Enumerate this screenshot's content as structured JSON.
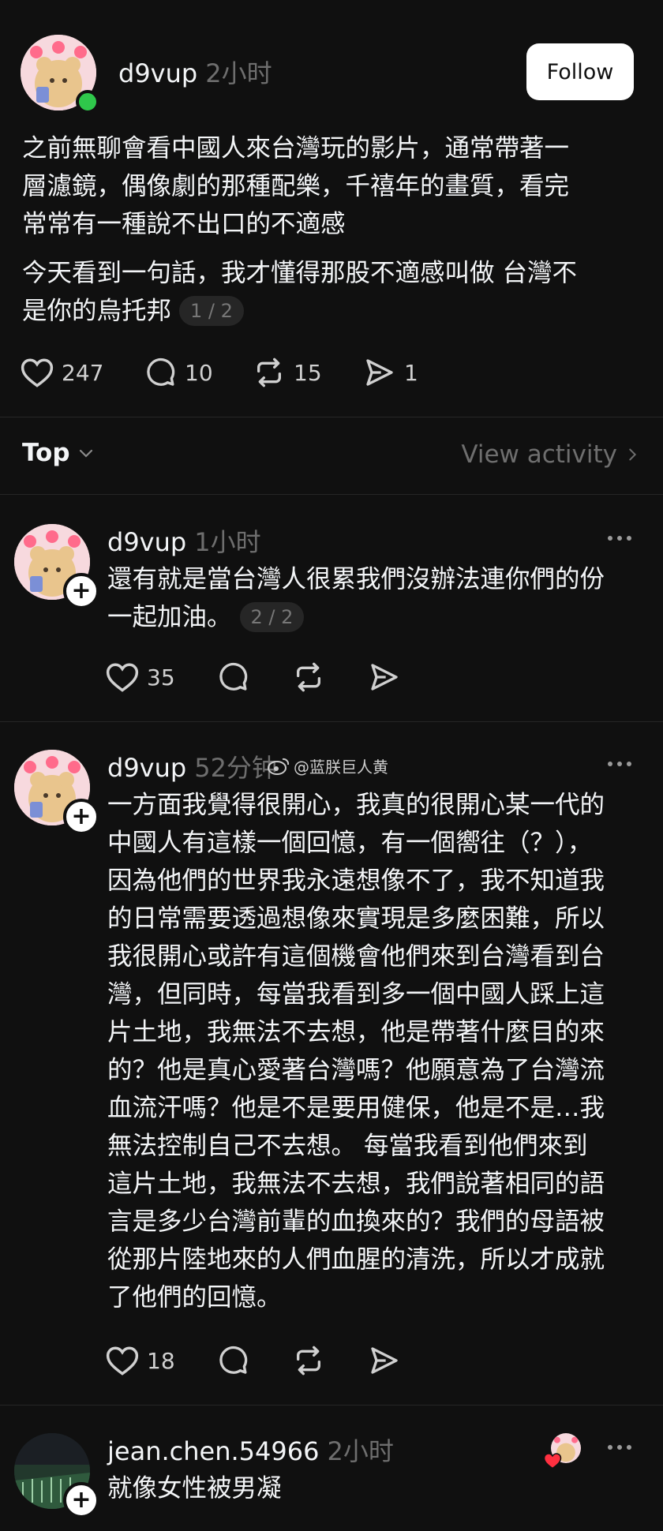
{
  "main_post": {
    "username": "d9vup",
    "time": "2小时",
    "follow_label": "Follow",
    "lines_p1": [
      "之前無聊會看中國人來台灣玩的影片，通常帶著一",
      "層濾鏡，偶像劇的那種配樂，千禧年的畫質，看完",
      "常常有一種說不出口的不適感"
    ],
    "lines_p2": [
      "今天看到一句話，我才懂得那股不適感叫做 台灣不",
      "是你的烏托邦"
    ],
    "pager": "1 / 2",
    "likes": "247",
    "comments": "10",
    "reposts": "15",
    "shares": "1"
  },
  "sort_bar": {
    "label": "Top",
    "activity_label": "View activity"
  },
  "reply1": {
    "username": "d9vup",
    "time": "1小时",
    "lines": [
      "還有就是當台灣人很累我們沒辦法連你們的份",
      "一起加油。"
    ],
    "pager": "2 / 2",
    "likes": "35"
  },
  "reply2": {
    "username": "d9vup",
    "time": "52分钟",
    "watermark": "@蓝朕巨人黄",
    "lines": [
      "一方面我覺得很開心，我真的很開心某一代的",
      "中國人有這樣一個回憶，有一個嚮往（？），",
      "因為他們的世界我永遠想像不了，我不知道我",
      "的日常需要透過想像來實現是多麼困難，所以",
      "我很開心或許有這個機會他們來到台灣看到台",
      "灣，但同時，每當我看到多一個中國人踩上這",
      "片土地，我無法不去想，他是帶著什麼目的來",
      "的？他是真心愛著台灣嗎？他願意為了台灣流",
      "血流汗嗎？他是不是要用健保，他是不是…我",
      "無法控制自己不去想。 每當我看到他們來到",
      "這片土地，我無法不去想，我們說著相同的語",
      "言是多少台灣前輩的血換來的？我們的母語被",
      "從那片陸地來的人們血腥的清洗，所以才成就",
      "了他們的回憶。"
    ],
    "likes": "18"
  },
  "reply3": {
    "username": "jean.chen.54966",
    "time": "2小时",
    "text": "就像女性被男凝"
  },
  "colors": {
    "background": "#101010",
    "text": "#f3f5f7",
    "muted": "#6e6e6e",
    "online": "#2fc84b",
    "like_heart": "#ff3040"
  }
}
